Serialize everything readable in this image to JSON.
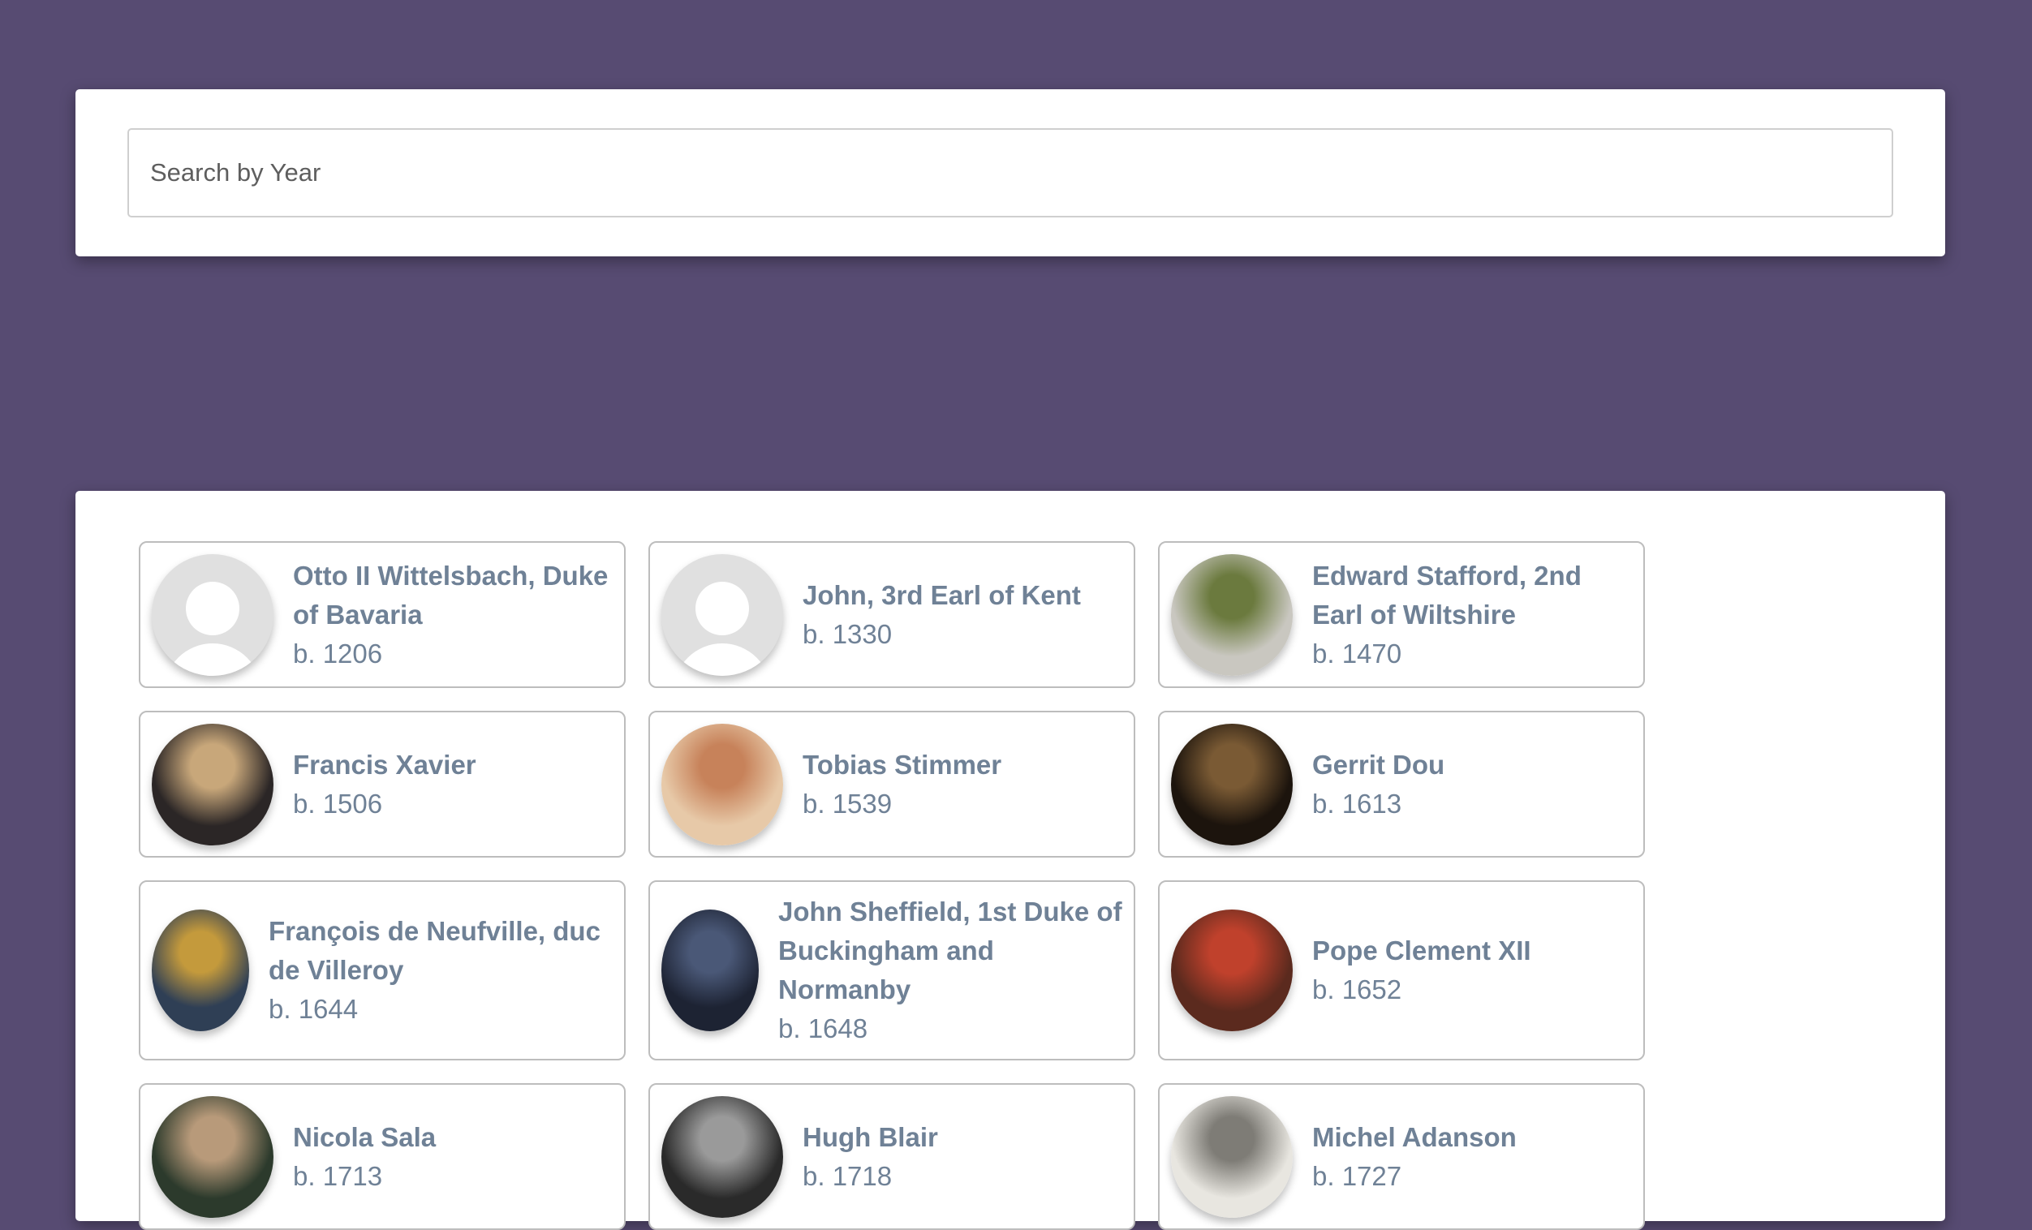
{
  "search": {
    "placeholder": "Search by Year",
    "value": ""
  },
  "people": [
    {
      "name": "Otto II Wittelsbach, Duke of Bavaria",
      "born": "b. 1206",
      "avatar": "placeholder",
      "photo_colors": [
        "#e0e0e0",
        "#e0e0e0"
      ]
    },
    {
      "name": "John, 3rd Earl of Kent",
      "born": "b. 1330",
      "avatar": "placeholder",
      "photo_colors": [
        "#e0e0e0",
        "#e0e0e0"
      ]
    },
    {
      "name": "Edward Stafford, 2nd Earl of Wiltshire",
      "born": "b. 1470",
      "avatar": "photo",
      "photo_colors": [
        "#c9c7c0",
        "#6b7a3e"
      ]
    },
    {
      "name": "Francis Xavier",
      "born": "b. 1506",
      "avatar": "photo",
      "photo_colors": [
        "#2b2626",
        "#c8a77a"
      ]
    },
    {
      "name": "Tobias Stimmer",
      "born": "b. 1539",
      "avatar": "photo",
      "photo_colors": [
        "#e7c9a8",
        "#c7825a"
      ]
    },
    {
      "name": "Gerrit Dou",
      "born": "b. 1613",
      "avatar": "photo",
      "photo_colors": [
        "#1c140d",
        "#7a5a34"
      ]
    },
    {
      "name": "François de Neufville, duc de Villeroy",
      "born": "b. 1644",
      "avatar": "photo",
      "photo_colors": [
        "#2f3f55",
        "#c49a3c"
      ]
    },
    {
      "name": "John Sheffield, 1st Duke of Buckingham and Normanby",
      "born": "b. 1648",
      "avatar": "photo",
      "photo_colors": [
        "#1d2333",
        "#4a5877"
      ]
    },
    {
      "name": "Pope Clement XII",
      "born": "b. 1652",
      "avatar": "photo",
      "photo_colors": [
        "#5b2a1e",
        "#c0412c"
      ]
    },
    {
      "name": "Nicola Sala",
      "born": "b. 1713",
      "avatar": "photo",
      "photo_colors": [
        "#2c3a2c",
        "#b89a7a"
      ]
    },
    {
      "name": "Hugh Blair",
      "born": "b. 1718",
      "avatar": "photo",
      "photo_colors": [
        "#2a2a2a",
        "#9a9a9a"
      ]
    },
    {
      "name": "Michel Adanson",
      "born": "b. 1727",
      "avatar": "photo",
      "photo_colors": [
        "#e8e6e0",
        "#7e7c76"
      ]
    }
  ]
}
